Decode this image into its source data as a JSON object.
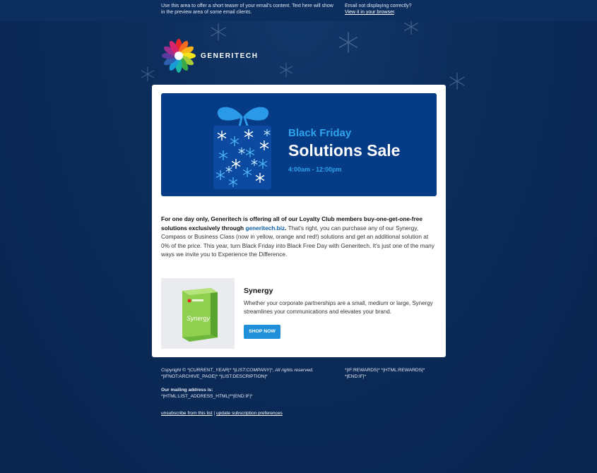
{
  "preheader": {
    "teaser": "Use this area to offer a short teaser of your email's content. Text here will show in the preview area of some email clients.",
    "not_displaying": "Email not displaying correctly?",
    "view_in_browser": "View it in your browser"
  },
  "logo": {
    "text": "GENERITECH",
    "icon": "flower-logo-icon"
  },
  "banner": {
    "subtitle": "Black Friday",
    "title": "Solutions Sale",
    "time": "4:00am - 12:00pm",
    "gift_icon": "snowflake-gift-icon"
  },
  "body": {
    "bold_intro": "For one day only, Generitech is offering all of our Loyalty Club members buy-one-get-one-free solutions exclusively through ",
    "link_text": "generitech.biz",
    "bold_period": ".",
    "rest": " That's right, you can purchase any of our Synergy, Compass or Business Class (now in yellow, orange and red!) solutions and get an additional solution at 0% of the price. This year, turn Black Friday into Black Free Day with Generitech. It's just one of the many ways we invite you to Experience the Difference."
  },
  "product": {
    "name": "Synergy",
    "box_label": "Synergy",
    "description": "Whether your corporate partnerships are a small, medium or large, Synergy streamlines your communications and elevates your brand.",
    "button": "SHOP NOW"
  },
  "footer": {
    "copyright": "Copyright © *|CURRENT_YEAR|* *|LIST:COMPANY|*, All rights reserved.",
    "archive": "*|IFNOT:ARCHIVE_PAGE|* *|LIST:DESCRIPTION|*",
    "rewards1": "*|IF:REWARDS|* *|HTML:REWARDS|*",
    "rewards2": "*|END:IF|*",
    "mailing_label": "Our mailing address is:",
    "mailing_value": "*|HTML:LIST_ADDRESS_HTML|**|END:IF|*",
    "unsubscribe": "unsubscribe from this list",
    "separator": "|",
    "update_prefs": "update subscription preferences"
  },
  "colors": {
    "background": "#0a2a55",
    "banner": "#063b86",
    "accent": "#2fa3ec",
    "button": "#1e8fd8"
  }
}
